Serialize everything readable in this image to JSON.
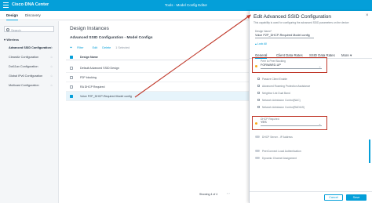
{
  "topbar": {
    "brand": "Cisco DNA Center",
    "breadcrumb": "Tools · Model Config Editor"
  },
  "tabs": {
    "design": "Design",
    "discovery": "Discovery"
  },
  "sidebar": {
    "search_placeholder": "Search",
    "group": "Wireless",
    "items": [
      {
        "label": "Advanced SSID Configuration"
      },
      {
        "label": "CleanAir Configuration"
      },
      {
        "label": "Dot11ax Configuration"
      },
      {
        "label": "Global IPv6 Configuration"
      },
      {
        "label": "Multicast Configuration"
      }
    ]
  },
  "main": {
    "title": "Design Instances",
    "subtitle": "Advanced SSID Configuration - Model Configs",
    "toolbar": {
      "filter": "Filter",
      "edit": "Edit",
      "delete": "Delete",
      "selected": "1 Selected"
    },
    "column_header": "Design Name",
    "rows": [
      {
        "name": "Default Advanced SSID Design"
      },
      {
        "name": "P2P blocking"
      },
      {
        "name": "RA DHCP Required"
      },
      {
        "name": "Voice P2P_DHCP-Required Model config"
      }
    ],
    "footer": "Showing 4 of 4"
  },
  "panel": {
    "title": "Edit Advanced SSID Configuration",
    "description": "This capability is used for configuring the advanced SSID parameters on the device",
    "name_label": "Design Name*",
    "name_value": "Voice P2P_DHCP-Required Model config",
    "lock_label": "Lock All",
    "tabs": {
      "general": "General",
      "client_data_rates": "Client Data Rates",
      "ssid_data_rates": "SSID Data Rates",
      "more": "More"
    },
    "peer_label": "Peer to Peer Blocking",
    "peer_value": "FORWARD-UP",
    "checkboxes": [
      "Passive Client Enable",
      "Advanced Roaming Protection Assistance",
      "Neighbor List Dual Band",
      "Network Admission Control(NAC)",
      "Network Admission Control(RADIUS)"
    ],
    "dhcp_label": "DHCP Required",
    "dhcp_value": "YES",
    "dhcp_server": "DHCP Server - IP Address",
    "toggles": [
      "PeerConnect Local Authentication",
      "Dynamic Channel Assignment"
    ],
    "cancel": "Cancel",
    "save": "Save"
  },
  "colors": {
    "accent": "#049fd9",
    "highlight": "#c0392b",
    "info": "#fbab18"
  }
}
